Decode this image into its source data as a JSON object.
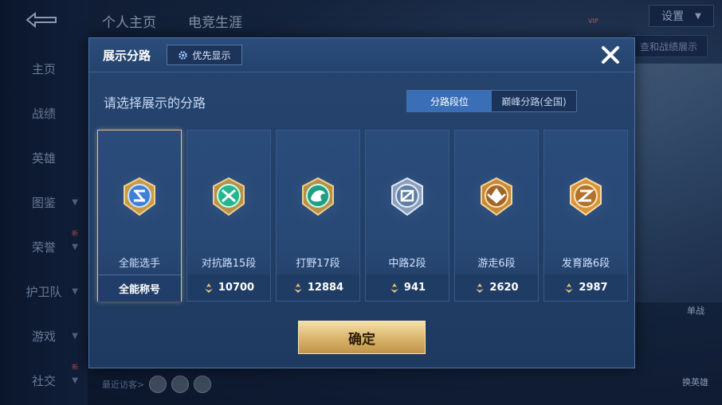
{
  "background": {
    "top_tabs": [
      "个人主页",
      "电竞生涯"
    ],
    "sidebar": [
      {
        "label": "主页",
        "chevron": false,
        "new": false
      },
      {
        "label": "战绩",
        "chevron": false,
        "new": false
      },
      {
        "label": "英雄",
        "chevron": false,
        "new": false
      },
      {
        "label": "图鉴",
        "chevron": true,
        "new": false
      },
      {
        "label": "荣誉",
        "chevron": true,
        "new": true
      },
      {
        "label": "护卫队",
        "chevron": true,
        "new": false
      },
      {
        "label": "游戏",
        "chevron": true,
        "new": false
      },
      {
        "label": "社交",
        "chevron": true,
        "new": true
      }
    ],
    "new_tag": "新",
    "settings_label": "设置",
    "right_chip": "查和战绩展示",
    "right_btn_1": "单战",
    "right_btn_2": "换英雄",
    "recent_visitors": "最近访客>",
    "vip_text": "VIP"
  },
  "dialog": {
    "title": "展示分路",
    "priority_label": "优先显示",
    "prompt": "请选择展示的分路",
    "tabs": [
      {
        "label": "分路段位",
        "active": true
      },
      {
        "label": "巅峰分路(全国)",
        "active": false
      }
    ],
    "cards": [
      {
        "name": "全能选手",
        "footer": "全能称号",
        "selected": true,
        "badge": "allround-badge-icon",
        "color": "#3f7fd6"
      },
      {
        "name": "对抗路15段",
        "footer": "10700",
        "selected": false,
        "badge": "clash-lane-badge-icon",
        "color": "#25b58f"
      },
      {
        "name": "打野17段",
        "footer": "12884",
        "selected": false,
        "badge": "jungle-dragon-badge-icon",
        "color": "#1f9e83"
      },
      {
        "name": "中路2段",
        "footer": "941",
        "selected": false,
        "badge": "mid-lane-badge-icon",
        "color": "#8aa6c8"
      },
      {
        "name": "游走6段",
        "footer": "2620",
        "selected": false,
        "badge": "roam-badge-icon",
        "color": "#c8893a"
      },
      {
        "name": "发育路6段",
        "footer": "2987",
        "selected": false,
        "badge": "farm-lane-badge-icon",
        "color": "#d99440"
      }
    ],
    "confirm_label": "确定"
  }
}
